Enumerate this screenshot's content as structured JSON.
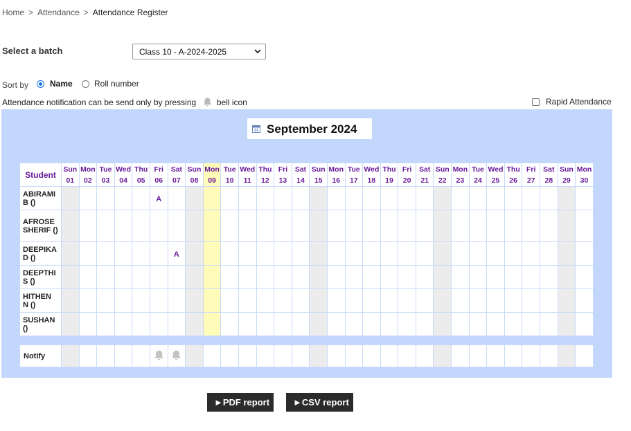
{
  "breadcrumb": {
    "home": "Home",
    "sep": ">",
    "attendance": "Attendance",
    "current": "Attendance Register"
  },
  "batch": {
    "label": "Select a batch",
    "selected": "Class 10 - A-2024-2025"
  },
  "sort": {
    "label": "Sort by",
    "options": [
      "Name",
      "Roll number"
    ],
    "selected": "Name"
  },
  "notification": {
    "text_before": "Attendance notification can be send only by pressing",
    "text_after": "bell icon"
  },
  "rapid": {
    "label": "Rapid Attendance",
    "checked": false
  },
  "register": {
    "month": "September 2024",
    "student_header": "Student",
    "days": [
      {
        "dow": "Sun",
        "d": "01"
      },
      {
        "dow": "Mon",
        "d": "02"
      },
      {
        "dow": "Tue",
        "d": "03"
      },
      {
        "dow": "Wed",
        "d": "04"
      },
      {
        "dow": "Thu",
        "d": "05"
      },
      {
        "dow": "Fri",
        "d": "06"
      },
      {
        "dow": "Sat",
        "d": "07"
      },
      {
        "dow": "Sun",
        "d": "08"
      },
      {
        "dow": "Mon",
        "d": "09"
      },
      {
        "dow": "Tue",
        "d": "10"
      },
      {
        "dow": "Wed",
        "d": "11"
      },
      {
        "dow": "Thu",
        "d": "12"
      },
      {
        "dow": "Fri",
        "d": "13"
      },
      {
        "dow": "Sat",
        "d": "14"
      },
      {
        "dow": "Sun",
        "d": "15"
      },
      {
        "dow": "Mon",
        "d": "16"
      },
      {
        "dow": "Tue",
        "d": "17"
      },
      {
        "dow": "Wed",
        "d": "18"
      },
      {
        "dow": "Thu",
        "d": "19"
      },
      {
        "dow": "Fri",
        "d": "20"
      },
      {
        "dow": "Sat",
        "d": "21"
      },
      {
        "dow": "Sun",
        "d": "22"
      },
      {
        "dow": "Mon",
        "d": "23"
      },
      {
        "dow": "Tue",
        "d": "24"
      },
      {
        "dow": "Wed",
        "d": "25"
      },
      {
        "dow": "Thu",
        "d": "26"
      },
      {
        "dow": "Fri",
        "d": "27"
      },
      {
        "dow": "Sat",
        "d": "28"
      },
      {
        "dow": "Sun",
        "d": "29"
      },
      {
        "dow": "Mon",
        "d": "30"
      }
    ],
    "highlight_day": "09",
    "students": [
      {
        "name": "ABIRAMI B ()",
        "absent": [
          "06"
        ]
      },
      {
        "name": "AFROSE SHERIF ()",
        "absent": []
      },
      {
        "name": "DEEPIKA D ()",
        "absent": [
          "07"
        ]
      },
      {
        "name": "DEEPTHI S ()",
        "absent": []
      },
      {
        "name": "HITHEN N ()",
        "absent": []
      },
      {
        "name": "SUSHAN ()",
        "absent": []
      }
    ],
    "absent_mark": "A",
    "notify_label": "Notify",
    "notify_bell_days": [
      "06",
      "07"
    ]
  },
  "icons": {
    "bell": "bell-icon",
    "calendar": "calendar-icon",
    "dropdown": "chevron-down-icon"
  },
  "colors": {
    "panel": "#c3d6fb",
    "header_text": "#6a1b9a",
    "today": "#fffbb8",
    "sunday": "#ececec",
    "button": "#2b2b2b"
  },
  "buttons": {
    "pdf": "►PDF report",
    "csv": "►CSV report"
  }
}
